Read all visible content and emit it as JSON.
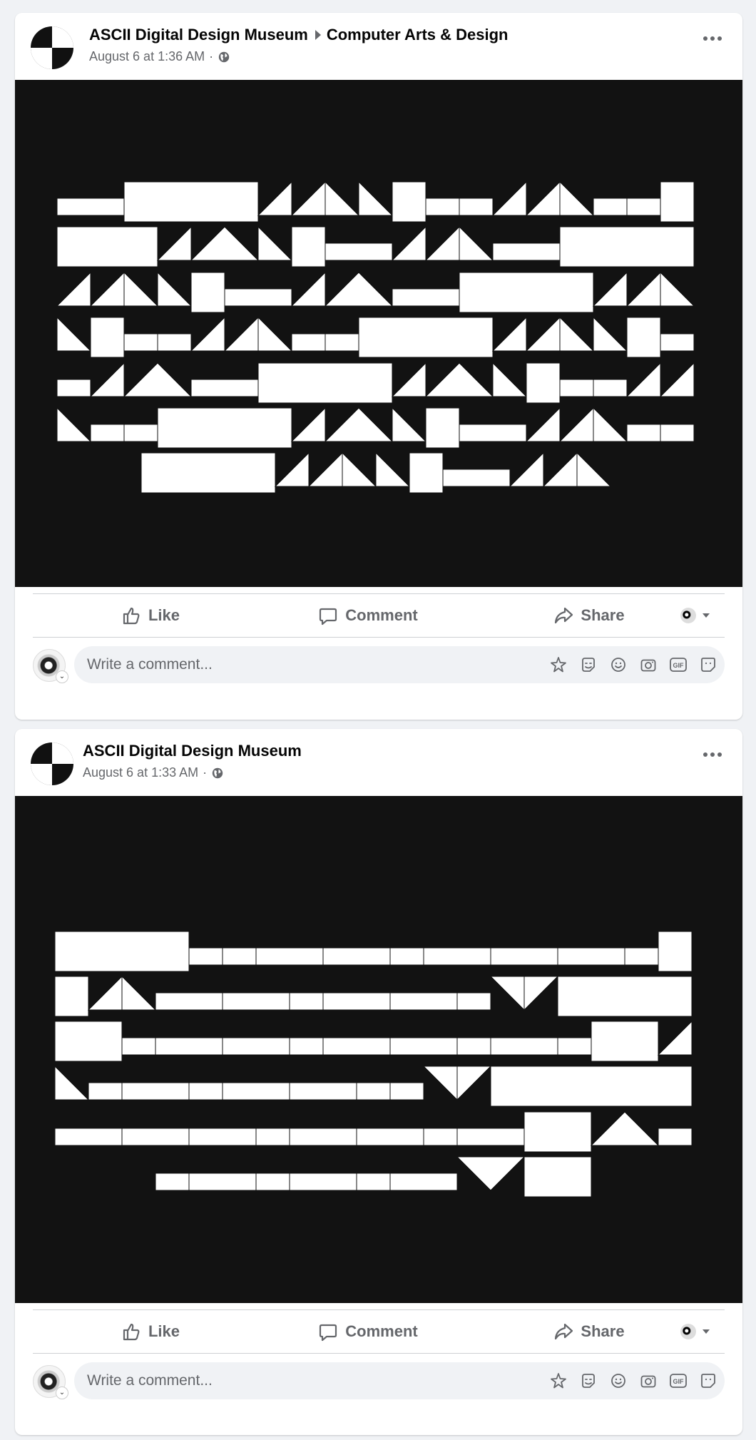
{
  "posts": [
    {
      "author": "ASCII Digital Design Museum",
      "group": "Computer Arts & Design",
      "timestamp": "August 6 at 1:36 AM",
      "separator": "·",
      "actions": {
        "like": "Like",
        "comment": "Comment",
        "share": "Share"
      },
      "comment_placeholder": "Write a comment..."
    },
    {
      "author": "ASCII Digital Design Museum",
      "timestamp": "August 6 at 1:33 AM",
      "separator": "·",
      "actions": {
        "like": "Like",
        "comment": "Comment",
        "share": "Share"
      },
      "comment_placeholder": "Write a comment..."
    }
  ],
  "icons": {
    "header": [
      "globe-icon",
      "more-options-icon"
    ],
    "actions": [
      "like-icon",
      "comment-icon",
      "share-icon",
      "audience-dropdown-icon"
    ],
    "comment_tools": [
      "avatar-sticker-icon",
      "sticker-icon",
      "emoji-icon",
      "camera-icon",
      "gif-icon",
      "sticker-face-icon"
    ]
  },
  "colors": {
    "page_background": "#f0f2f5",
    "card": "#ffffff",
    "artwork_background": "#121212",
    "artwork_shapes": "#ffffff",
    "secondary_text": "#65676b"
  }
}
